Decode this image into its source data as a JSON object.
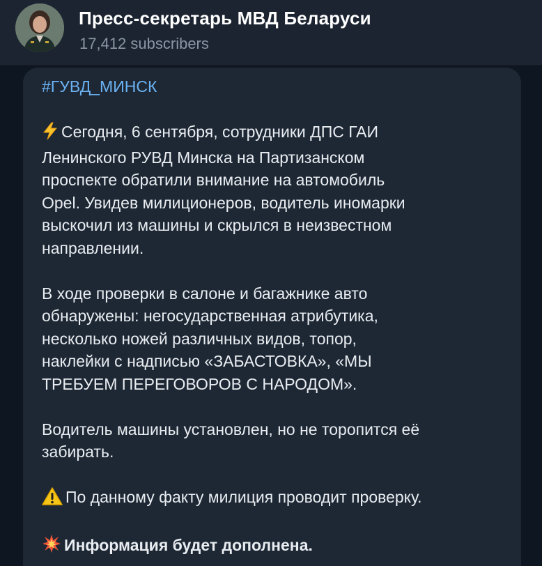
{
  "header": {
    "title": "Пресс-секретарь МВД Беларуси",
    "subscribers": "17,412 subscribers"
  },
  "message": {
    "hashtag": "#ГУВД_МИНСК",
    "p1": [
      "Сегодня, 6 сентября, сотрудники ДПС ГАИ",
      "Ленинского РУВД Минска на  Партизанском",
      "проспекте обратили внимание на автомобиль",
      "Opel.  Увидев милиционеров, водитель иномарки",
      "выскочил из машины и скрылся в неизвестном",
      "направлении."
    ],
    "p2": [
      "В ходе проверки в салоне и багажнике авто",
      "обнаружены: негосударственная атрибутика,",
      "несколько ножей различных видов, топор,",
      "наклейки с надписью «ЗАБАСТОВКА», «МЫ",
      "ТРЕБУЕМ ПЕРЕГОВОРОВ С НАРОДОМ»."
    ],
    "p3": [
      "Водитель машины установлен, но не торопится её",
      "забирать."
    ],
    "p4": "По данному факту милиция проводит проверку.",
    "p5": "Информация будет дополнена.",
    "icons": {
      "p1": "lightning-emoji",
      "p4": "warning-emoji",
      "p5": "collision-emoji"
    }
  },
  "colors": {
    "background": "#0e1621",
    "header": "#1c2431",
    "bubble": "#1e2835",
    "hashtag": "#6bb2f2",
    "text": "#e9edf1",
    "subtext": "#8a96a5"
  }
}
